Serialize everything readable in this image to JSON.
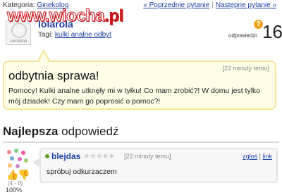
{
  "breadcrumb": {
    "label": "Kategoria:",
    "link": "Ginekolog"
  },
  "nav": {
    "prev": "« Poprzednie pytanie",
    "next": "Następne pytanie »"
  },
  "watermark": {
    "text": "www.wiocha",
    "suffix": ".pl"
  },
  "question": {
    "username": "lolarola",
    "avatar_caption": "samokop",
    "tags_label": "Tagi:",
    "tags": "kulki analne odbyt",
    "answers_label": "odpowiedzi",
    "answers_count": "16",
    "time": "[22 minuty temu]",
    "title": "odbytnia sprawa!",
    "body": "Pomocy! Kulki analne utknęły mi w tyłku! Co mam zrobić?! W domu jest tylko mój dziadek! Czy mam go poprosić o pomoc?!"
  },
  "best_answer": {
    "heading_bold": "Najlepsza",
    "heading_rest": " odpowiedź",
    "username": "blejdas",
    "stars": "★★★★★",
    "rating": 0,
    "time": "[22 minuty temu]",
    "report": "zgłoś",
    "link": "link",
    "body": "spróbuj odkurzaczem",
    "votes": "(4 - 0)",
    "percent": "100%"
  },
  "colors": {
    "link": "#1a3fa6",
    "bubble_bg": "#fffde6",
    "bubble_border": "#f5e596",
    "watermark": "#c8161d"
  }
}
